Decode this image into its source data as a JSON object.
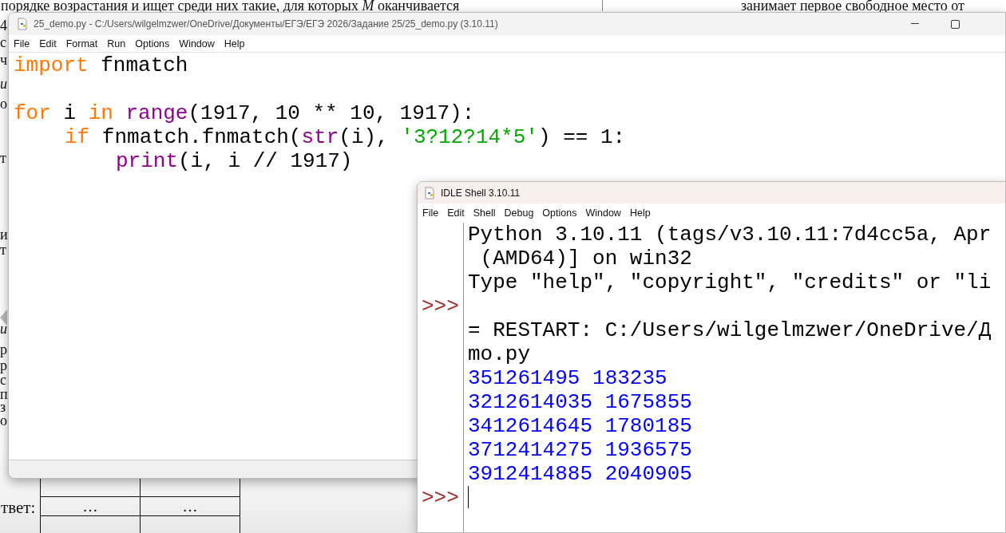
{
  "document": {
    "top_line": "порядке возрастания и ищет среди них такие, для которых *M* оканчивается",
    "right_line": "занимает первое свободное место от",
    "margin_fragments": [
      {
        "text": "4",
        "italic": false
      },
      {
        "text": "с",
        "italic": false
      },
      {
        "text": "ч",
        "italic": false
      },
      {
        "text": "и",
        "italic": true
      },
      {
        "text": "о",
        "italic": false
      },
      {
        "text": "т",
        "italic": false
      },
      {
        "text": "и",
        "italic": false
      },
      {
        "text": "т",
        "italic": false
      },
      {
        "text": "и",
        "italic": true
      },
      {
        "text": "р",
        "italic": false
      },
      {
        "text": "р",
        "italic": false
      },
      {
        "text": "с",
        "italic": false
      },
      {
        "text": "п",
        "italic": false
      },
      {
        "text": "з",
        "italic": false
      },
      {
        "text": "о",
        "italic": false
      }
    ],
    "answer_label": "твет:",
    "answer_cells": [
      "…",
      "…"
    ]
  },
  "editor": {
    "title": "25_demo.py - C:/Users/wilgelmzwer/OneDrive/Документы/ЕГЭ/ЕГЭ 2026/Задание 25/25_demo.py (3.10.11)",
    "menu": [
      "File",
      "Edit",
      "Format",
      "Run",
      "Options",
      "Window",
      "Help"
    ],
    "code_lines": [
      {
        "gap_before": false,
        "tokens": [
          {
            "kind": "keyword",
            "text": "import"
          },
          {
            "kind": "plain",
            "text": " fnmatch"
          }
        ]
      },
      {
        "gap_before": true,
        "tokens": [
          {
            "kind": "keyword",
            "text": "for"
          },
          {
            "kind": "plain",
            "text": " i "
          },
          {
            "kind": "keyword",
            "text": "in"
          },
          {
            "kind": "builtin",
            "text": " range"
          },
          {
            "kind": "plain",
            "text": "(1917, 10 ** 10, 1917):"
          }
        ],
        "children": [
          {
            "gap_before": false,
            "tokens": [
              {
                "kind": "keyword",
                "text": "if"
              },
              {
                "kind": "plain",
                "text": " fnmatch.fnmatch("
              },
              {
                "kind": "builtin",
                "text": "str"
              },
              {
                "kind": "plain",
                "text": "(i), "
              },
              {
                "kind": "string",
                "text": "'3?12?14*5'"
              },
              {
                "kind": "plain",
                "text": ") == 1:"
              }
            ],
            "children": [
              {
                "gap_before": false,
                "tokens": [
                  {
                    "kind": "builtin",
                    "text": "print"
                  },
                  {
                    "kind": "plain",
                    "text": "(i, i // 1917)"
                  }
                ]
              }
            ]
          }
        ]
      }
    ]
  },
  "shell": {
    "title": "IDLE Shell 3.10.11",
    "menu": [
      "File",
      "Edit",
      "Shell",
      "Debug",
      "Options",
      "Window",
      "Help"
    ],
    "lines": [
      {
        "kind": "info",
        "text": "Python 3.10.11 (tags/v3.10.11:7d4cc5a, Apr"
      },
      {
        "kind": "info",
        "text": " (AMD64)] on win32"
      },
      {
        "kind": "info",
        "text": "Type \"help\", \"copyright\", \"credits\" or \"li"
      },
      {
        "kind": "prompt",
        "prompt": ">>>",
        "cursor": false
      },
      {
        "kind": "info",
        "text": "= RESTART: C:/Users/wilgelmzwer/OneDrive/Д"
      },
      {
        "kind": "info",
        "text": "mo.py"
      },
      {
        "kind": "output",
        "text": "351261495 183235"
      },
      {
        "kind": "output",
        "text": "3212614035 1675855"
      },
      {
        "kind": "output",
        "text": "3412614645 1780185"
      },
      {
        "kind": "output",
        "text": "3712414275 1936575"
      },
      {
        "kind": "output",
        "text": "3912414885 2040905"
      },
      {
        "kind": "prompt",
        "prompt": ">>>",
        "cursor": true
      }
    ]
  }
}
